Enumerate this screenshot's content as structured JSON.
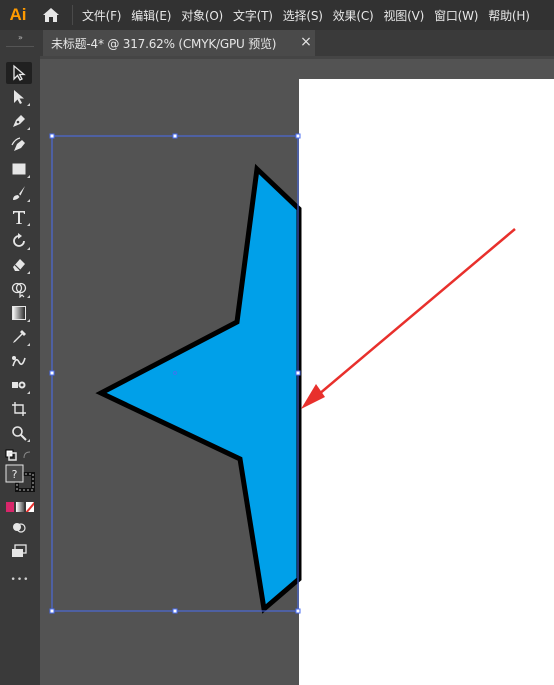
{
  "app": {
    "logo": "Ai",
    "home_icon": "home-icon"
  },
  "menu": {
    "items": [
      "文件(F)",
      "编辑(E)",
      "对象(O)",
      "文字(T)",
      "选择(S)",
      "效果(C)",
      "视图(V)",
      "窗口(W)",
      "帮助(H)"
    ]
  },
  "document_tab": {
    "title": "未标题-4* @ 317.62% (CMYK/GPU 预览)",
    "close_label": "×"
  },
  "toolbar": {
    "grip_label": "»",
    "more_label": "•••",
    "tools": [
      "selection-tool",
      "direct-selection-tool",
      "pen-tool",
      "curvature-tool",
      "rectangle-tool",
      "paintbrush-tool",
      "type-tool",
      "rotate-tool",
      "eraser-tool",
      "shape-builder-tool",
      "gradient-tool",
      "eyedropper-tool",
      "blend-tool",
      "symbol-sprayer-tool",
      "artboard-tool",
      "zoom-tool"
    ]
  },
  "colors": {
    "star_fill": "#00a0e9",
    "star_stroke": "#000000",
    "selection": "#4a6cf0",
    "annotation_arrow": "#e8302c",
    "logo": "#ff9a00"
  }
}
